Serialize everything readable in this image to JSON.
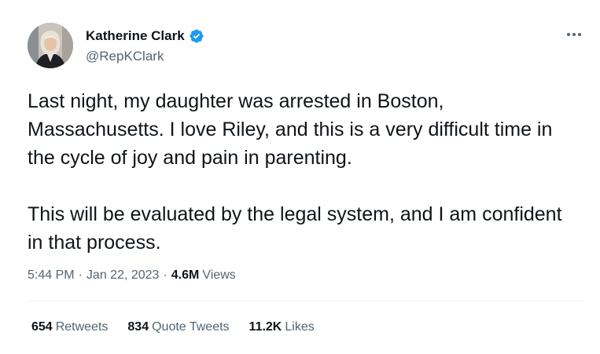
{
  "author": {
    "display_name": "Katherine Clark",
    "handle": "@RepKClark",
    "verified": true
  },
  "tweet": {
    "paragraphs": [
      "Last night, my daughter was arrested in Boston, Massachusetts. I love Riley, and this is a very difficult time in the cycle of joy and pain in parenting.",
      "This will be evaluated by the legal system, and I am confident in that process."
    ]
  },
  "meta": {
    "time": "5:44 PM",
    "separator": "·",
    "date": "Jan 22, 2023",
    "views_count": "4.6M",
    "views_label": "Views"
  },
  "stats": {
    "retweets_count": "654",
    "retweets_label": "Retweets",
    "quotes_count": "834",
    "quotes_label": "Quote Tweets",
    "likes_count": "11.2K",
    "likes_label": "Likes"
  },
  "icons": {
    "verified": "verified-badge-icon",
    "more": "more-options-icon"
  },
  "colors": {
    "verified_blue": "#1d9bf0",
    "secondary_text": "#536471",
    "primary_text": "#0f1419"
  }
}
